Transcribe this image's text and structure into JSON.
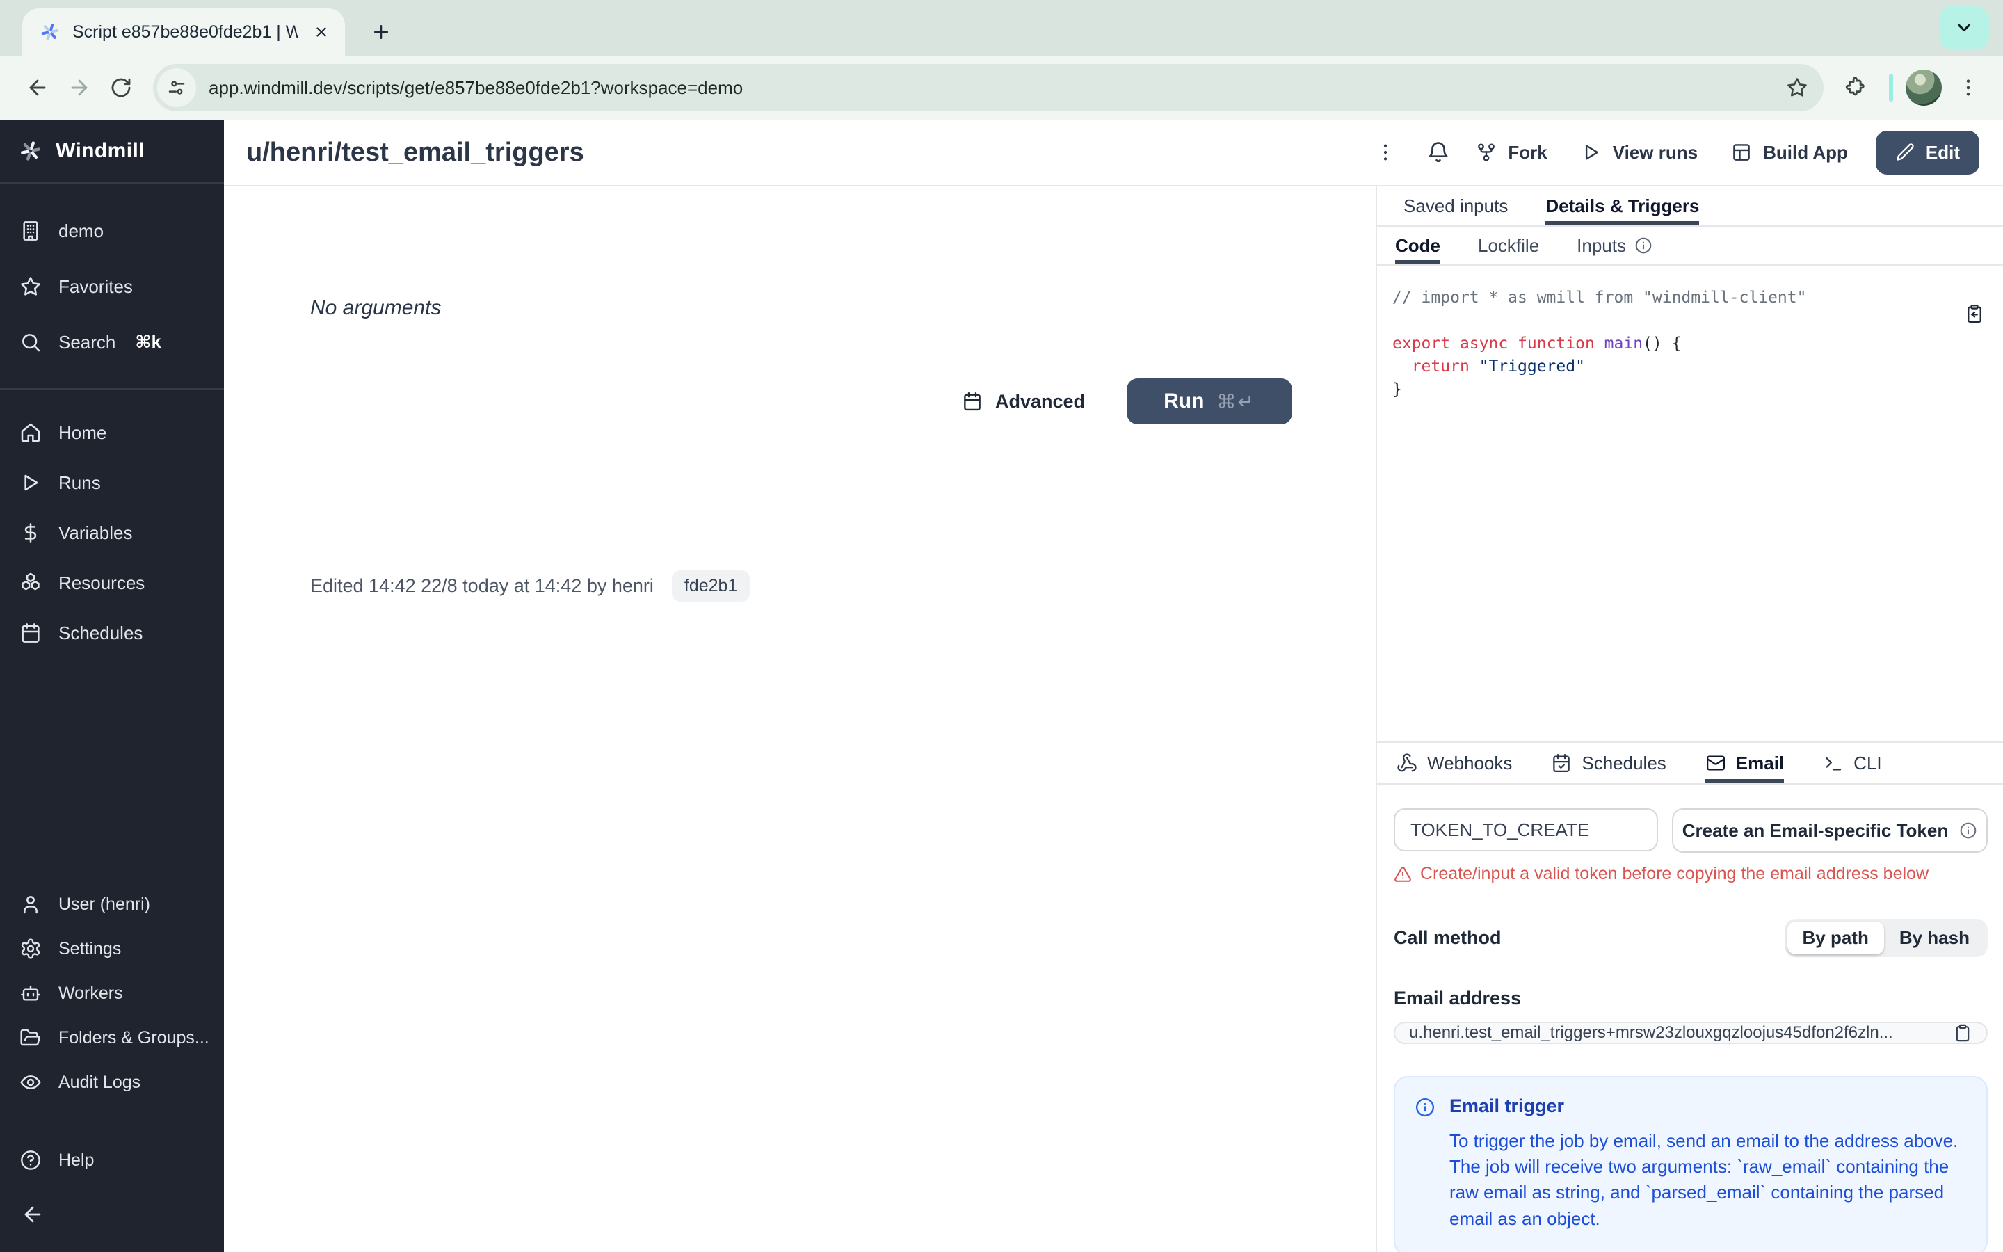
{
  "browser": {
    "tab_title": "Script e857be88e0fde2b1 | W",
    "url": "app.windmill.dev/scripts/get/e857be88e0fde2b1?workspace=demo"
  },
  "sidebar": {
    "brand": "Windmill",
    "items_top": [
      {
        "label": "demo"
      },
      {
        "label": "Favorites"
      },
      {
        "label": "Search",
        "shortcut": "⌘k"
      }
    ],
    "items_main": [
      {
        "label": "Home"
      },
      {
        "label": "Runs"
      },
      {
        "label": "Variables"
      },
      {
        "label": "Resources"
      },
      {
        "label": "Schedules"
      }
    ],
    "items_bottom": [
      {
        "label": "User (henri)"
      },
      {
        "label": "Settings"
      },
      {
        "label": "Workers"
      },
      {
        "label": "Folders & Groups..."
      },
      {
        "label": "Audit Logs"
      }
    ],
    "help": "Help"
  },
  "header": {
    "title": "u/henri/test_email_triggers",
    "fork": "Fork",
    "view_runs": "View runs",
    "build_app": "Build App",
    "edit": "Edit"
  },
  "runform": {
    "no_arguments": "No arguments",
    "advanced": "Advanced",
    "run": "Run",
    "run_shortcut": "⌘↵",
    "edited": "Edited 14:42 22/8 today at 14:42 by henri",
    "hash": "fde2b1"
  },
  "panel": {
    "tab_saved_inputs": "Saved inputs",
    "tab_details": "Details & Triggers",
    "subtab_code": "Code",
    "subtab_lockfile": "Lockfile",
    "subtab_inputs": "Inputs",
    "code": {
      "comment": "// import * as wmill from \"windmill-client\"",
      "kw_export": "export ",
      "kw_async": "async ",
      "kw_function": "function ",
      "fn_main": "main",
      "sig_tail": "() {",
      "ret_indent": "  ",
      "kw_return": "return ",
      "str_value": "\"Triggered\"",
      "brace_close": "}"
    },
    "trigger_tabs": [
      {
        "label": "Webhooks"
      },
      {
        "label": "Schedules"
      },
      {
        "label": "Email"
      },
      {
        "label": "CLI"
      }
    ],
    "email": {
      "token_value": "TOKEN_TO_CREATE",
      "create_button": "Create an Email-specific Token",
      "warning": "Create/input a valid token before copying the email address below",
      "call_method": "Call method",
      "by_path": "By path",
      "by_hash": "By hash",
      "address_label": "Email address",
      "address_value": "u.henri.test_email_triggers+mrsw23zlouxgqzloojus45dfon2f6zln...",
      "info_title": "Email trigger",
      "info_body": "To trigger the job by email, send an email to the address above. The job will receive two arguments: `raw_email` containing the raw email as string, and `parsed_email` containing the parsed email as an object."
    }
  },
  "colors": {
    "primary_button": "#3f4f68",
    "sidebar_bg": "#1f242f",
    "warning_red": "#d9534f",
    "info_bg": "#eff6ff",
    "info_title": "#1e40af",
    "info_body": "#1d4ed8",
    "code_keyword": "#d73a49",
    "code_function": "#6f42c1",
    "code_string": "#0a3069",
    "code_comment": "#6a737d",
    "tabstrip_bg": "#d9e4de",
    "toolbar_bg": "#f1f6f3"
  }
}
